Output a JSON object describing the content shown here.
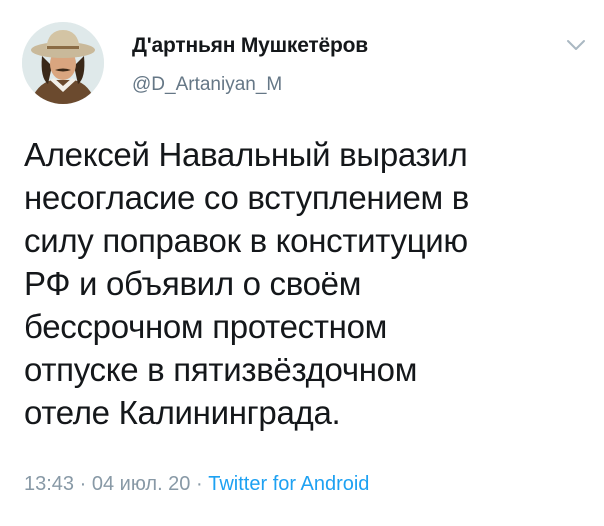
{
  "tweet": {
    "display_name": "Д'артньян Мушкетёров",
    "handle": "@D_Artaniyan_M",
    "text": "Алексей Навальный выразил\nнесогласие со вступлением в\nсилу поправок в конституцию\nРФ и объявил о своём\nбессрочном протестном\nотпуске в пятизвёздочном\nотеле Калининграда.",
    "time": "13:43",
    "date": "04 июл. 20",
    "separator": "·",
    "client": "Twitter for Android"
  },
  "icons": {
    "avatar": "profile-photo-man-in-hat",
    "more": "chevron-down-icon"
  },
  "colors": {
    "text": "#14171a",
    "secondary": "#657786",
    "link": "#1da1f2"
  }
}
